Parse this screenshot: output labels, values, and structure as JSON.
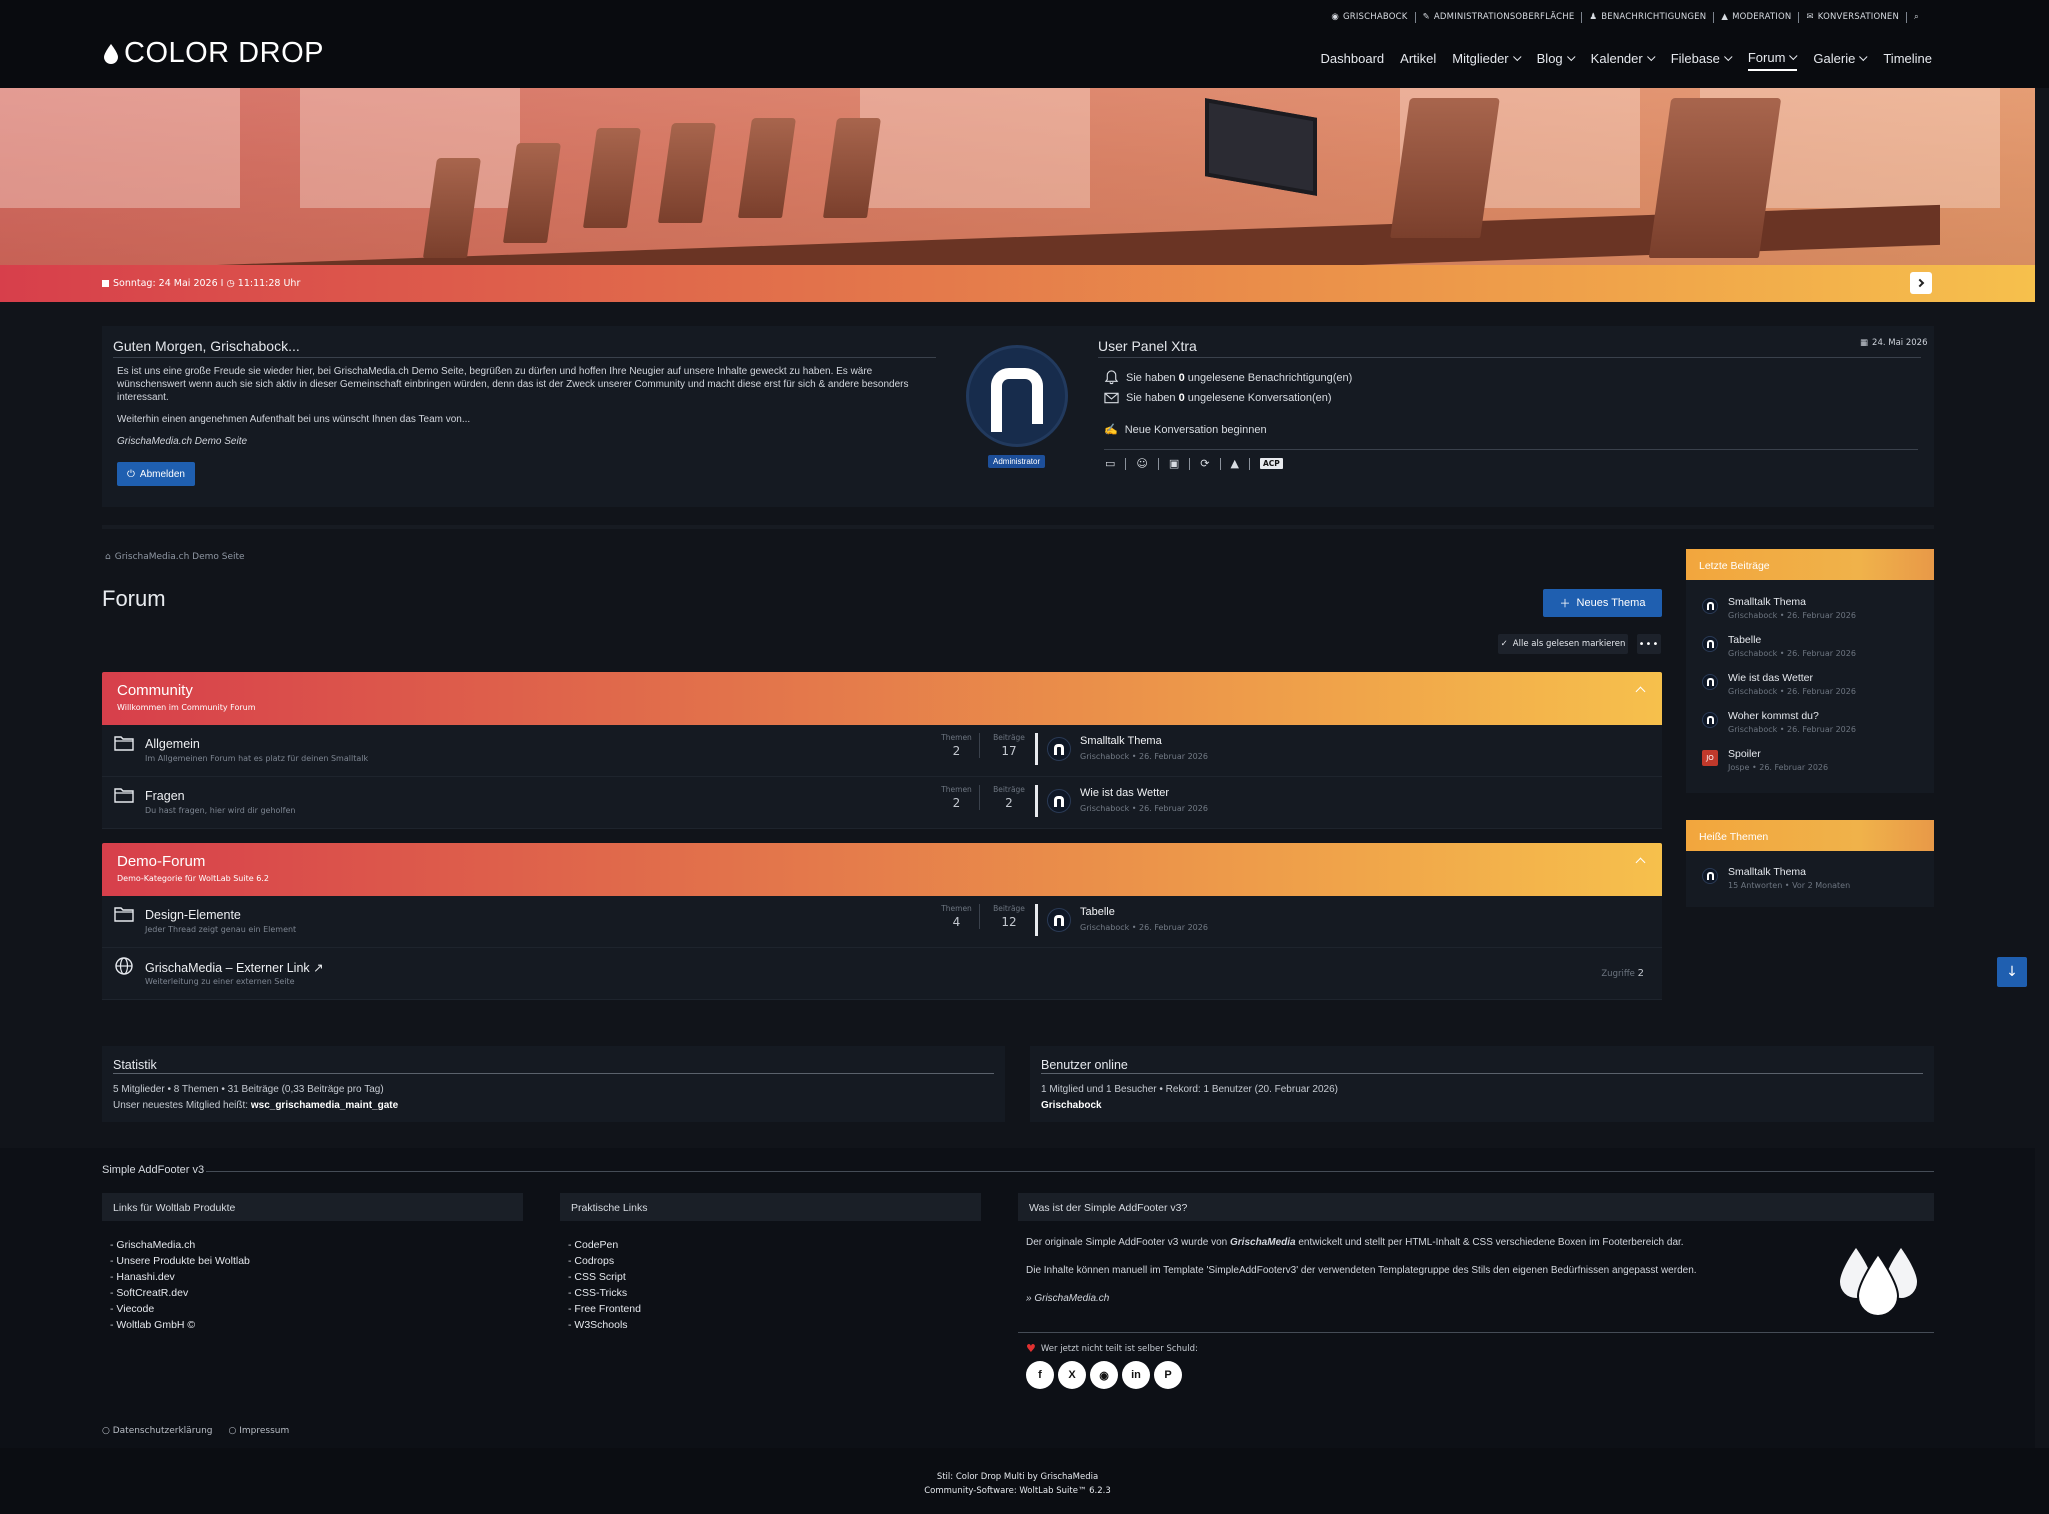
{
  "usernav": [
    "GRISCHABOCK",
    "ADMINISTRATIONSOBERFLÄCHE",
    "BENACHRICHTIGUNGEN",
    "MODERATION",
    "KONVERSATIONEN"
  ],
  "logo": "COLOR DROP",
  "mainnav": [
    {
      "label": "Dashboard",
      "dropdown": false,
      "active": false
    },
    {
      "label": "Artikel",
      "dropdown": false,
      "active": false
    },
    {
      "label": "Mitglieder",
      "dropdown": true,
      "active": false
    },
    {
      "label": "Blog",
      "dropdown": true,
      "active": false
    },
    {
      "label": "Kalender",
      "dropdown": true,
      "active": false
    },
    {
      "label": "Filebase",
      "dropdown": true,
      "active": false
    },
    {
      "label": "Forum",
      "dropdown": true,
      "active": true
    },
    {
      "label": "Galerie",
      "dropdown": true,
      "active": false
    },
    {
      "label": "Timeline",
      "dropdown": false,
      "active": false
    }
  ],
  "datebar": "Sonntag: 24 Mai 2026 I ◷ 11:11:28 Uhr",
  "welcome": {
    "title": "Guten Morgen, Grischabock...",
    "p1": "Es ist uns eine große Freude sie wieder hier, bei GrischaMedia.ch Demo Seite, begrüßen zu dürfen und hoffen Ihre Neugier auf unsere Inhalte geweckt zu haben. Es wäre wünschenswert wenn auch sie sich aktiv in dieser Gemeinschaft einbringen würden, denn das ist der Zweck unserer Community und macht diese erst für sich & andere besonders interessant.",
    "p2": "Weiterhin einen angenehmen Aufenthalt bei uns wünscht Ihnen das Team von...",
    "sig": "GrischaMedia.ch Demo Seite",
    "logout": "Abmelden",
    "badge": "Administrator"
  },
  "userpanel": {
    "title": "User Panel Xtra",
    "date": "24. Mai 2026",
    "notif_pre": "Sie haben",
    "notif_count": "0",
    "notif_post": "ungelesene Benachrichtigung(en)",
    "conv_pre": "Sie haben",
    "conv_count": "0",
    "conv_post": "ungelesene Konversation(en)",
    "newconv": "Neue Konversation beginnen",
    "acp": "ACP"
  },
  "breadcrumb": "GrischaMedia.ch Demo Seite",
  "forum_title": "Forum",
  "new_topic": "Neues Thema",
  "mark_read": "Alle als gelesen markieren",
  "categories": [
    {
      "title": "Community",
      "desc": "Willkommen im Community Forum",
      "boards": [
        {
          "name": "Allgemein",
          "desc": "Im Allgemeinen Forum hat es platz für deinen Smalltalk",
          "l1": "Themen",
          "v1": "2",
          "l2": "Beiträge",
          "v2": "17",
          "last": "Smalltalk Thema",
          "meta": "Grischabock • 26. Februar 2026"
        },
        {
          "name": "Fragen",
          "desc": "Du hast fragen, hier wird dir geholfen",
          "l1": "Themen",
          "v1": "2",
          "l2": "Beiträge",
          "v2": "2",
          "last": "Wie ist das Wetter",
          "meta": "Grischabock • 26. Februar 2026"
        }
      ]
    },
    {
      "title": "Demo-Forum",
      "desc": "Demo-Kategorie für WoltLab Suite 6.2",
      "boards": [
        {
          "name": "Design-Elemente",
          "desc": "Jeder Thread zeigt genau ein Element",
          "l1": "Themen",
          "v1": "4",
          "l2": "Beiträge",
          "v2": "12",
          "last": "Tabelle",
          "meta": "Grischabock • 26. Februar 2026"
        }
      ],
      "link": {
        "name": "GrischaMedia – Externer Link ↗",
        "desc": "Weiterleitung zu einer externen Seite",
        "label": "Zugriffe",
        "value": "2"
      }
    }
  ],
  "sidebar": {
    "latest_title": "Letzte Beiträge",
    "latest": [
      {
        "title": "Smalltalk Thema",
        "meta": "Grischabock • 26. Februar 2026",
        "av": ""
      },
      {
        "title": "Tabelle",
        "meta": "Grischabock • 26. Februar 2026",
        "av": ""
      },
      {
        "title": "Wie ist das Wetter",
        "meta": "Grischabock • 26. Februar 2026",
        "av": ""
      },
      {
        "title": "Woher kommst du?",
        "meta": "Grischabock • 26. Februar 2026",
        "av": ""
      },
      {
        "title": "Spoiler",
        "meta": "Jospe • 26. Februar 2026",
        "av": "JO"
      }
    ],
    "hot_title": "Heiße Themen",
    "hot": [
      {
        "title": "Smalltalk Thema",
        "meta": "15 Antworten • Vor 2 Monaten"
      }
    ]
  },
  "stats": {
    "title": "Statistik",
    "line1": "5 Mitglieder • 8 Themen • 31 Beiträge (0,33 Beiträge pro Tag)",
    "line2_pre": "Unser neuestes Mitglied heißt:",
    "line2_name": "wsc_grischamedia_maint_gate"
  },
  "online": {
    "title": "Benutzer online",
    "line1": "1 Mitglied und 1 Besucher • Rekord: 1 Benutzer (20. Februar 2026)",
    "line2": "Grischabock"
  },
  "footer": {
    "title": "Simple AddFooter v3",
    "col1_title": "Links für Woltlab Produkte",
    "col1": [
      "GrischaMedia.ch",
      "Unsere Produkte bei Woltlab",
      "Hanashi.dev",
      "SoftCreatR.dev",
      "Viecode",
      "Woltlab GmbH ©"
    ],
    "col2_title": "Praktische Links",
    "col2": [
      "CodePen",
      "Codrops",
      "CSS Script",
      "CSS-Tricks",
      "Free Frontend",
      "W3Schools"
    ],
    "col3_title": "Was ist der Simple AddFooter v3?",
    "about1_pre": "Der originale Simple AddFooter v3 wurde von",
    "about1_brand": "GrischaMedia",
    "about1_post": "entwickelt und stellt per HTML-Inhalt & CSS verschiedene Boxen im Footerbereich dar.",
    "about2": "Die Inhalte können manuell im Template 'SimpleAddFooterv3' der verwendeten Templategruppe des Stils den eigenen Bedürfnissen angepasst werden.",
    "about3": "» GrischaMedia.ch",
    "share": "Wer jetzt nicht teilt ist selber Schuld:",
    "legal": [
      "Datenschutzerklärung",
      "Impressum"
    ],
    "credit1": "Stil: Color Drop Multi by GrischaMedia",
    "credit2": "Community-Software: WoltLab Suite™ 6.2.3"
  },
  "colors": {
    "accent_start": "#d73f4b",
    "accent_end": "#f6c04c",
    "button": "#1f5fb0",
    "bg": "#11141a",
    "panel": "#151a22"
  }
}
